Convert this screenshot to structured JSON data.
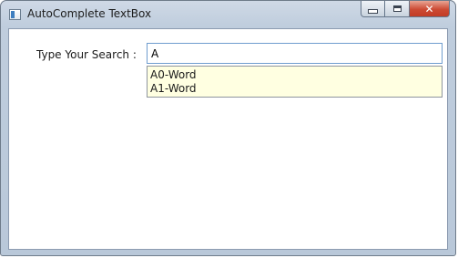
{
  "window": {
    "title": "AutoComplete TextBox",
    "icon": "app-window-icon"
  },
  "caption": {
    "minimize_icon": "minimize-icon",
    "maximize_icon": "maximize-icon",
    "close_icon": "close-icon",
    "close_glyph": "✕",
    "close_color": "#c23c26"
  },
  "form": {
    "search_label": "Type Your Search :",
    "search_value": "A"
  },
  "suggestions": {
    "items": [
      {
        "label": "A0-Word"
      },
      {
        "label": "A1-Word"
      }
    ],
    "background": "#ffffe1"
  }
}
